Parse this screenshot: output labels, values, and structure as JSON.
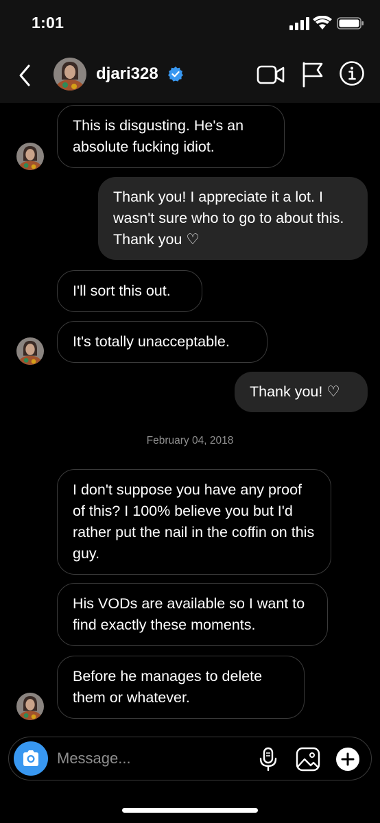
{
  "status_bar": {
    "time": "1:01"
  },
  "header": {
    "username": "djari328",
    "verified": true,
    "icons": [
      "back-icon",
      "video-call-icon",
      "flag-icon",
      "info-icon"
    ]
  },
  "messages": [
    {
      "from": "them",
      "text": "This is disgusting. He's an absolute fucking idiot."
    },
    {
      "from": "me",
      "text": "Thank you! I appreciate it a lot. I wasn't sure who to go to about this. Thank you ♡"
    },
    {
      "from": "them",
      "text": "I'll sort this out."
    },
    {
      "from": "them",
      "text": "It's totally unacceptable."
    },
    {
      "from": "me",
      "text": "Thank you! ♡"
    },
    {
      "from": "them",
      "text": "I don't suppose you have any proof of this? I 100% believe you but I'd rather put the nail in the coffin on this guy."
    },
    {
      "from": "them",
      "text": "His VODs are available so I want to find exactly these moments."
    },
    {
      "from": "them",
      "text": "Before he manages to delete them or whatever."
    }
  ],
  "date_separator": "February 04, 2018",
  "composer": {
    "placeholder": "Message...",
    "icons": [
      "camera-icon",
      "microphone-icon",
      "gallery-icon",
      "plus-icon"
    ]
  },
  "colors": {
    "background": "#000000",
    "header_bg": "#121212",
    "outgoing_bubble": "#262626",
    "incoming_border": "#3a3a3a",
    "accent": "#3897f0"
  }
}
